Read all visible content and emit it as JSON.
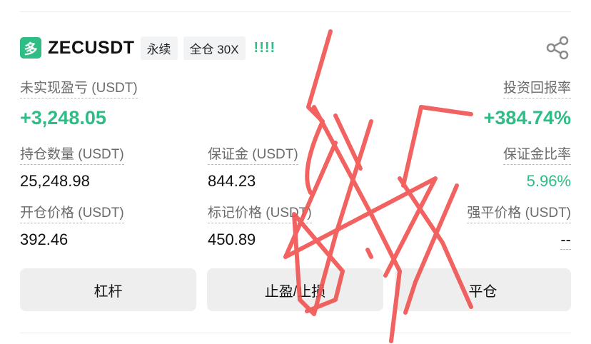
{
  "header": {
    "side_badge": "多",
    "symbol": "ZECUSDT",
    "contract_type": "永续",
    "margin_mode": "全仓 30X",
    "risk_indicator": "!!!!",
    "share_icon": "share-icon"
  },
  "pnl": {
    "unrealized_label": "未实现盈亏 (USDT)",
    "unrealized_value": "+3,248.05",
    "roe_label": "投资回报率",
    "roe_value": "+384.74%"
  },
  "stats": {
    "position_size_label": "持仓数量 (USDT)",
    "position_size_value": "25,248.98",
    "margin_label": "保证金 (USDT)",
    "margin_value": "844.23",
    "margin_ratio_label": "保证金比率",
    "margin_ratio_value": "5.96%",
    "entry_price_label": "开仓价格 (USDT)",
    "entry_price_value": "392.46",
    "mark_price_label": "标记价格 (USDT)",
    "mark_price_value": "450.89",
    "liq_price_label": "强平价格 (USDT)",
    "liq_price_value": "--"
  },
  "actions": {
    "leverage_label": "杠杆",
    "tpsl_label": "止盈/止损",
    "close_label": "平仓"
  },
  "colors": {
    "positive": "#2ebd85",
    "scribble": "#f0524f",
    "button_bg": "#eeeeee"
  }
}
